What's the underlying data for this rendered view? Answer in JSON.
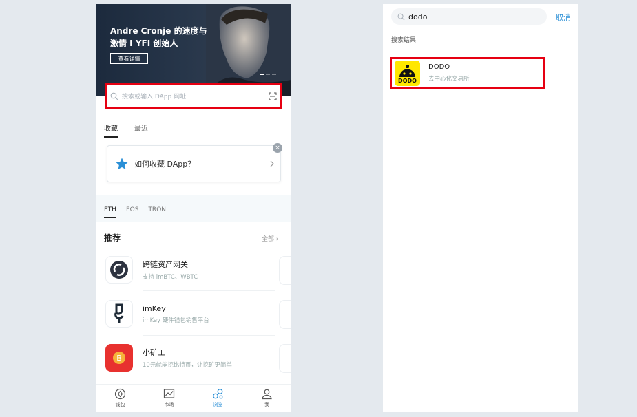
{
  "left_screen": {
    "banner": {
      "title": "Andre Cronje 的速度与激情 I YFI 创始人",
      "button": "查看详情"
    },
    "search": {
      "placeholder": "搜索或输入 DApp 网址"
    },
    "tabs": [
      "收藏",
      "最近"
    ],
    "tip": {
      "text": "如何收藏 DApp？",
      "close": "×"
    },
    "chain_tabs": [
      "ETH",
      "EOS",
      "TRON"
    ],
    "recommend": {
      "title": "推荐",
      "all": "全部 ›",
      "items": [
        {
          "name": "跨链资产网关",
          "desc": "支持 imBTC、WBTC",
          "icon": "cross-chain-icon"
        },
        {
          "name": "imKey",
          "desc": "imKey 硬件钱包销售平台",
          "icon": "imkey-icon"
        },
        {
          "name": "小矿工",
          "desc": "10元就能挖比特币，让挖矿更简单",
          "icon": "miner-icon"
        }
      ]
    },
    "nav": [
      {
        "label": "钱包",
        "icon": "wallet-icon"
      },
      {
        "label": "市场",
        "icon": "market-icon"
      },
      {
        "label": "浏览",
        "icon": "browse-icon",
        "active": true
      },
      {
        "label": "我",
        "icon": "user-icon"
      }
    ]
  },
  "right_screen": {
    "search_value": "dodo",
    "cancel": "取消",
    "results_label": "搜索结果",
    "result": {
      "name": "DODO",
      "desc": "去中心化交易所",
      "icon_text": "DODO"
    }
  },
  "colors": {
    "accent": "#2a8fd6",
    "highlight": "#e60012",
    "dodo_yellow": "#ffe700"
  }
}
